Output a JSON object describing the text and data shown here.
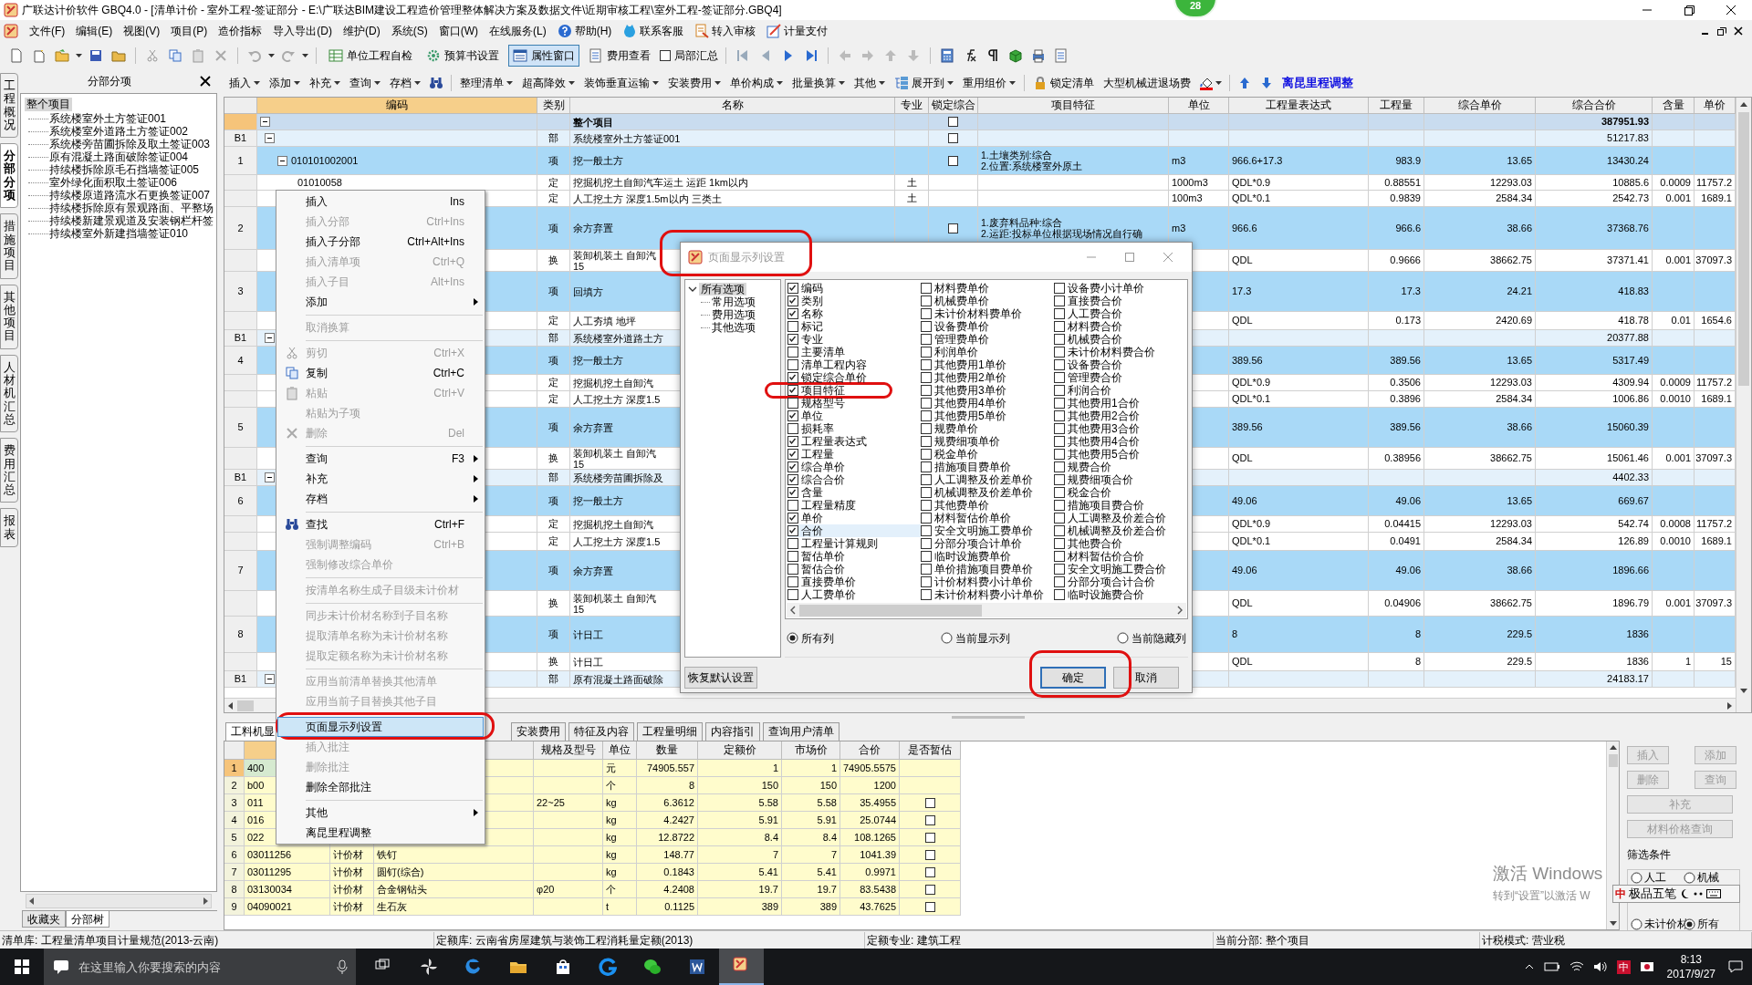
{
  "window": {
    "title": "广联达计价软件 GBQ4.0 - [清单计价 - 室外工程-签证部分 - E:\\广联达BIM建设工程造价管理整体解决方案及数据文件\\近期审核工程\\室外工程-签证部分.GBQ4]",
    "badge": "28"
  },
  "menu_bar": [
    {
      "label": "文件(F)",
      "kind": "plain"
    },
    {
      "label": "编辑(E)",
      "kind": "plain"
    },
    {
      "label": "视图(V)",
      "kind": "plain"
    },
    {
      "label": "项目(P)",
      "kind": "plain"
    },
    {
      "label": "造价指标",
      "kind": "plain"
    },
    {
      "label": "导入导出(D)",
      "kind": "plain"
    },
    {
      "label": "维护(D)",
      "kind": "plain"
    },
    {
      "label": "系统(S)",
      "kind": "plain"
    },
    {
      "label": "窗口(W)",
      "kind": "plain"
    },
    {
      "label": "在线服务(L)",
      "kind": "plain"
    },
    {
      "label": "帮助(H)",
      "kind": "icon"
    },
    {
      "label": "联系客服",
      "kind": "icon"
    },
    {
      "label": "转入审核",
      "kind": "icon"
    },
    {
      "label": "计量支付",
      "kind": "icon"
    }
  ],
  "toolbar": {
    "buttons": [
      {
        "label": "单位工程自检",
        "pressed": false
      },
      {
        "label": "预算书设置",
        "pressed": false
      },
      {
        "label": "属性窗口",
        "pressed": true
      },
      {
        "label": "费用查看",
        "pressed": false
      }
    ],
    "summary_checkbox": {
      "label": "局部汇总",
      "checked": false
    }
  },
  "grid_toolbar": [
    {
      "label": "插入",
      "kind": "dropdown"
    },
    {
      "label": "添加",
      "kind": "dropdown"
    },
    {
      "label": "补充",
      "kind": "dropdown"
    },
    {
      "label": "查询",
      "kind": "dropdown"
    },
    {
      "label": "存档",
      "kind": "dropdown"
    },
    {
      "label": "整理清单",
      "kind": "dropdown"
    },
    {
      "label": "超高降效",
      "kind": "dropdown"
    },
    {
      "label": "装饰垂直运输",
      "kind": "dropdown"
    },
    {
      "label": "安装费用",
      "kind": "dropdown"
    },
    {
      "label": "单价构成",
      "kind": "dropdown"
    },
    {
      "label": "批量换算",
      "kind": "dropdown"
    },
    {
      "label": "其他",
      "kind": "dropdown"
    },
    {
      "label": "展开到",
      "kind": "dropdown"
    },
    {
      "label": "重用组价",
      "kind": "dropdown"
    },
    {
      "label": "锁定清单",
      "kind": "plain"
    },
    {
      "label": "大型机械进退场费",
      "kind": "plain"
    },
    {
      "label": "离昆里程调整",
      "kind": "accent"
    }
  ],
  "side_tabs": [
    {
      "label": "工程概况",
      "selected": false
    },
    {
      "label": "分部分项",
      "selected": true
    },
    {
      "label": "措施项目",
      "selected": false
    },
    {
      "label": "其他项目",
      "selected": false
    },
    {
      "label": "人材机汇总",
      "selected": false
    },
    {
      "label": "费用汇总",
      "selected": false
    },
    {
      "label": "报表",
      "selected": false
    }
  ],
  "tree_panel": {
    "title": "分部分项",
    "root": {
      "label": "整个项目",
      "selected": true,
      "children": [
        {
          "label": "系统楼室外土方签证001",
          "selected": false
        },
        {
          "label": "系统楼室外道路土方签证002",
          "selected": false
        },
        {
          "label": "系统楼旁苗圃拆除及取土签证003",
          "selected": false
        },
        {
          "label": "原有混凝土路面破除签证004",
          "selected": false
        },
        {
          "label": "持续楼拆除原毛石挡墙签证005",
          "selected": false
        },
        {
          "label": "室外绿化面积取土签证006",
          "selected": false
        },
        {
          "label": "持续楼原道路流水石更换签证007",
          "selected": false
        },
        {
          "label": "持续楼拆除原有景观路面、平整场",
          "selected": false
        },
        {
          "label": "持续楼新建景观道及安装钢栏杆签",
          "selected": false
        },
        {
          "label": "持续楼室外新建挡墙签证010",
          "selected": false
        }
      ]
    },
    "tabs": [
      {
        "label": "收藏夹",
        "selected": false
      },
      {
        "label": "分部树",
        "selected": true
      }
    ]
  },
  "grid": {
    "columns": [
      "编码",
      "类别",
      "名称",
      "专业",
      "锁定综合",
      "项目特征",
      "单位",
      "工程量表达式",
      "工程量",
      "综合单价",
      "综合合价",
      "含量",
      "单价"
    ],
    "rows": [
      {
        "kind": "total",
        "selected": true,
        "expanded": true,
        "name": "整个项目",
        "locked": false,
        "total": "387951.93"
      },
      {
        "kind": "division",
        "selected": false,
        "num": "B1",
        "expanded": true,
        "type": "部",
        "name": "系统楼室外土方签证001",
        "locked": false,
        "total": "51217.83"
      },
      {
        "kind": "item",
        "selected": false,
        "num": "1",
        "expanded": true,
        "code": "010101002001",
        "type": "项",
        "name": "挖一般土方",
        "locked": false,
        "feature": [
          "1.土壤类别:综合",
          "2.位置:系统楼室外原土"
        ],
        "unit": "m3",
        "expr": "966.6+17.3",
        "qty": "983.9",
        "unit_price": "13.65",
        "total": "13430.24"
      },
      {
        "kind": "quota",
        "selected": false,
        "code": "01010058",
        "type": "定",
        "name": "挖掘机挖土自卸汽车运土 运距 1km以内",
        "spec": "土",
        "unit": "1000m3",
        "expr": "QDL*0.9",
        "qty": "0.88551",
        "unit_price": "12293.03",
        "total": "10885.6",
        "content": "0.0009",
        "price": "11757.2"
      },
      {
        "kind": "quota",
        "selected": false,
        "type": "定",
        "name": "人工挖土方 深度1.5m以内 三类土",
        "spec": "土",
        "unit": "100m3",
        "expr": "QDL*0.1",
        "qty": "0.9839",
        "unit_price": "2584.34",
        "total": "2542.73",
        "content": "0.001",
        "price": "1689.1"
      },
      {
        "kind": "item",
        "selected": false,
        "num": "2",
        "type": "项",
        "name": "余方弃置",
        "locked": false,
        "feature": [
          "1.废弃料品种:综合",
          "2.运距:投标单位根据现场情况自行确"
        ],
        "unit": "m3",
        "expr": "966.6",
        "qty": "966.6",
        "unit_price": "38.66",
        "total": "37368.76"
      },
      {
        "kind": "swap",
        "selected": false,
        "type": "换",
        "name": "装卸机装土 自卸汽",
        "name_extra": "15",
        "expr": "QDL",
        "qty": "0.9666",
        "unit_price": "38662.75",
        "total": "37371.41",
        "content": "0.001",
        "price": "37097.3"
      },
      {
        "kind": "item",
        "selected": false,
        "num": "3",
        "type": "项",
        "name": "回填方",
        "expr": "17.3",
        "qty": "17.3",
        "unit_price": "24.21",
        "total": "418.83"
      },
      {
        "kind": "quota",
        "selected": false,
        "type": "定",
        "name": "人工夯填 地坪",
        "expr": "QDL",
        "qty": "0.173",
        "unit_price": "2420.69",
        "total": "418.78",
        "content": "0.01",
        "price": "1654.6"
      },
      {
        "kind": "division",
        "selected": false,
        "num": "B1",
        "expanded": true,
        "type": "部",
        "name": "系统楼室外道路土方",
        "total": "20377.88"
      },
      {
        "kind": "item",
        "selected": false,
        "num": "4",
        "type": "项",
        "name": "挖一般土方",
        "expr": "389.56",
        "qty": "389.56",
        "unit_price": "13.65",
        "total": "5317.49"
      },
      {
        "kind": "quota",
        "selected": false,
        "type": "定",
        "name": "挖掘机挖土自卸汽",
        "expr": "QDL*0.9",
        "qty": "0.3506",
        "unit_price": "12293.03",
        "total": "4309.94",
        "content": "0.0009",
        "price": "11757.2"
      },
      {
        "kind": "quota",
        "selected": false,
        "type": "定",
        "name": "人工挖土方 深度1.5",
        "expr": "QDL*0.1",
        "qty": "0.3896",
        "unit_price": "2584.34",
        "total": "1006.86",
        "content": "0.0010",
        "price": "1689.1"
      },
      {
        "kind": "item",
        "selected": false,
        "num": "5",
        "type": "项",
        "name": "余方弃置",
        "expr": "389.56",
        "qty": "389.56",
        "unit_price": "38.66",
        "total": "15060.39"
      },
      {
        "kind": "swap",
        "selected": false,
        "type": "换",
        "name": "装卸机装土 自卸汽",
        "name_extra": "15",
        "expr": "QDL",
        "qty": "0.38956",
        "unit_price": "38662.75",
        "total": "15061.46",
        "content": "0.001",
        "price": "37097.3"
      },
      {
        "kind": "division",
        "selected": false,
        "num": "B1",
        "expanded": true,
        "type": "部",
        "name": "系统楼旁苗圃拆除及",
        "total": "4402.33"
      },
      {
        "kind": "item",
        "selected": false,
        "num": "6",
        "type": "项",
        "name": "挖一般土方",
        "expr": "49.06",
        "qty": "49.06",
        "unit_price": "13.65",
        "total": "669.67"
      },
      {
        "kind": "quota",
        "selected": false,
        "type": "定",
        "name": "挖掘机挖土自卸汽",
        "expr": "QDL*0.9",
        "qty": "0.04415",
        "unit_price": "12293.03",
        "total": "542.74",
        "content": "0.0008",
        "price": "11757.2"
      },
      {
        "kind": "quota",
        "selected": false,
        "type": "定",
        "name": "人工挖土方 深度1.5",
        "expr": "QDL*0.1",
        "qty": "0.0491",
        "unit_price": "2584.34",
        "total": "126.89",
        "content": "0.0010",
        "price": "1689.1"
      },
      {
        "kind": "item",
        "selected": false,
        "num": "7",
        "type": "项",
        "name": "余方弃置",
        "expr": "49.06",
        "qty": "49.06",
        "unit_price": "38.66",
        "total": "1896.66"
      },
      {
        "kind": "swap",
        "selected": false,
        "type": "换",
        "name": "装卸机装土 自卸汽",
        "name_extra": "15",
        "expr": "QDL",
        "qty": "0.04906",
        "unit_price": "38662.75",
        "total": "1896.79",
        "content": "0.001",
        "price": "37097.3"
      },
      {
        "kind": "item",
        "selected": false,
        "num": "8",
        "type": "项",
        "name": "计日工",
        "expr": "8",
        "qty": "8",
        "unit_price": "229.5",
        "total": "1836"
      },
      {
        "kind": "swap",
        "selected": false,
        "type": "换",
        "name": "计日工",
        "expr": "QDL",
        "qty": "8",
        "unit_price": "229.5",
        "total": "1836",
        "content": "1",
        "price": "15"
      },
      {
        "kind": "division",
        "selected": false,
        "num": "B1",
        "expanded": true,
        "type": "部",
        "name": "原有混凝土路面破除",
        "total": "24183.17"
      }
    ]
  },
  "context_menu": [
    {
      "kind": "command",
      "label": "插入",
      "shortcut": "Ins",
      "disabled": false,
      "selected": false
    },
    {
      "kind": "command",
      "label": "插入分部",
      "shortcut": "Ctrl+Ins",
      "disabled": true,
      "selected": false
    },
    {
      "kind": "command",
      "label": "插入子分部",
      "shortcut": "Ctrl+Alt+Ins",
      "disabled": false,
      "selected": false
    },
    {
      "kind": "command",
      "label": "插入清单项",
      "shortcut": "Ctrl+Q",
      "disabled": true,
      "selected": false
    },
    {
      "kind": "command",
      "label": "插入子目",
      "shortcut": "Alt+Ins",
      "disabled": true,
      "selected": false
    },
    {
      "kind": "submenu",
      "label": "添加",
      "disabled": false,
      "selected": false
    },
    {
      "kind": "separator"
    },
    {
      "kind": "command",
      "label": "取消换算",
      "disabled": true,
      "selected": false
    },
    {
      "kind": "separator"
    },
    {
      "kind": "command",
      "label": "剪切",
      "shortcut": "Ctrl+X",
      "disabled": true,
      "selected": false
    },
    {
      "kind": "command",
      "label": "复制",
      "shortcut": "Ctrl+C",
      "disabled": false,
      "selected": false
    },
    {
      "kind": "command",
      "label": "粘贴",
      "shortcut": "Ctrl+V",
      "disabled": true,
      "selected": false
    },
    {
      "kind": "command",
      "label": "粘贴为子项",
      "disabled": true,
      "selected": false
    },
    {
      "kind": "command",
      "label": "删除",
      "shortcut": "Del",
      "disabled": true,
      "selected": false
    },
    {
      "kind": "separator"
    },
    {
      "kind": "submenu",
      "label": "查询",
      "shortcut": "F3",
      "disabled": false,
      "selected": false
    },
    {
      "kind": "submenu",
      "label": "补充",
      "disabled": false,
      "selected": false
    },
    {
      "kind": "submenu",
      "label": "存档",
      "disabled": false,
      "selected": false
    },
    {
      "kind": "separator"
    },
    {
      "kind": "command",
      "label": "查找",
      "shortcut": "Ctrl+F",
      "disabled": false,
      "selected": false
    },
    {
      "kind": "command",
      "label": "强制调整编码",
      "shortcut": "Ctrl+B",
      "disabled": true,
      "selected": false
    },
    {
      "kind": "command",
      "label": "强制修改综合单价",
      "disabled": true,
      "selected": false
    },
    {
      "kind": "separator"
    },
    {
      "kind": "command",
      "label": "按清单名称生成子目级未计价材",
      "disabled": true,
      "selected": false
    },
    {
      "kind": "separator"
    },
    {
      "kind": "command",
      "label": "同步未计价材名称到子目名称",
      "disabled": true,
      "selected": false
    },
    {
      "kind": "command",
      "label": "提取清单名称为未计价材名称",
      "disabled": true,
      "selected": false
    },
    {
      "kind": "command",
      "label": "提取定额名称为未计价材名称",
      "disabled": true,
      "selected": false
    },
    {
      "kind": "separator"
    },
    {
      "kind": "command",
      "label": "应用当前清单替换其他清单",
      "disabled": true,
      "selected": false
    },
    {
      "kind": "command",
      "label": "应用当前子目替换其他子目",
      "disabled": true,
      "selected": false
    },
    {
      "kind": "separator"
    },
    {
      "kind": "command",
      "label": "页面显示列设置",
      "disabled": false,
      "selected": true
    },
    {
      "kind": "command",
      "label": "插入批注",
      "disabled": true,
      "selected": false
    },
    {
      "kind": "command",
      "label": "删除批注",
      "disabled": true,
      "selected": false
    },
    {
      "kind": "command",
      "label": "删除全部批注",
      "disabled": false,
      "selected": false
    },
    {
      "kind": "separator"
    },
    {
      "kind": "submenu",
      "label": "其他",
      "disabled": false,
      "selected": false
    },
    {
      "kind": "command",
      "label": "离昆里程调整",
      "disabled": false,
      "selected": false
    }
  ],
  "dialog": {
    "title": "页面显示列设置",
    "tree": {
      "label": "所有选项",
      "expanded": true,
      "selected": true,
      "children": [
        {
          "label": "常用选项"
        },
        {
          "label": "费用选项"
        },
        {
          "label": "其他选项"
        }
      ]
    },
    "columns": [
      [
        {
          "label": "编码",
          "checked": true,
          "selected": false
        },
        {
          "label": "类别",
          "checked": true,
          "selected": false
        },
        {
          "label": "名称",
          "checked": true,
          "selected": false
        },
        {
          "label": "标记",
          "checked": false,
          "selected": false
        },
        {
          "label": "专业",
          "checked": true,
          "selected": false
        },
        {
          "label": "主要清单",
          "checked": false,
          "selected": false
        },
        {
          "label": "清单工程内容",
          "checked": false,
          "selected": false
        },
        {
          "label": "锁定综合单价",
          "checked": true,
          "selected": false
        },
        {
          "label": "项目特征",
          "checked": true,
          "selected": false
        },
        {
          "label": "规格型号",
          "checked": false,
          "selected": false
        },
        {
          "label": "单位",
          "checked": true,
          "selected": false
        },
        {
          "label": "损耗率",
          "checked": false,
          "selected": false
        },
        {
          "label": "工程量表达式",
          "checked": true,
          "selected": false
        },
        {
          "label": "工程量",
          "checked": true,
          "selected": false
        },
        {
          "label": "综合单价",
          "checked": true,
          "selected": false
        },
        {
          "label": "综合合价",
          "checked": true,
          "selected": false
        },
        {
          "label": "含量",
          "checked": true,
          "selected": false
        },
        {
          "label": "工程量精度",
          "checked": false,
          "selected": false
        },
        {
          "label": "单价",
          "checked": true,
          "selected": false
        },
        {
          "label": "合价",
          "checked": true,
          "selected": true
        },
        {
          "label": "工程量计算规则",
          "checked": false,
          "selected": false
        },
        {
          "label": "暂估单价",
          "checked": false,
          "selected": false
        },
        {
          "label": "暂估合价",
          "checked": false,
          "selected": false
        },
        {
          "label": "直接费单价",
          "checked": false,
          "selected": false
        },
        {
          "label": "人工费单价",
          "checked": false,
          "selected": false
        }
      ],
      [
        {
          "label": "材料费单价",
          "checked": false,
          "selected": false
        },
        {
          "label": "机械费单价",
          "checked": false,
          "selected": false
        },
        {
          "label": "未计价材料费单价",
          "checked": false,
          "selected": false
        },
        {
          "label": "设备费单价",
          "checked": false,
          "selected": false
        },
        {
          "label": "管理费单价",
          "checked": false,
          "selected": false
        },
        {
          "label": "利润单价",
          "checked": false,
          "selected": false
        },
        {
          "label": "其他费用1单价",
          "checked": false,
          "selected": false
        },
        {
          "label": "其他费用2单价",
          "checked": false,
          "selected": false
        },
        {
          "label": "其他费用3单价",
          "checked": false,
          "selected": false
        },
        {
          "label": "其他费用4单价",
          "checked": false,
          "selected": false
        },
        {
          "label": "其他费用5单价",
          "checked": false,
          "selected": false
        },
        {
          "label": "规费单价",
          "checked": false,
          "selected": false
        },
        {
          "label": "规费细项单价",
          "checked": false,
          "selected": false
        },
        {
          "label": "税金单价",
          "checked": false,
          "selected": false
        },
        {
          "label": "措施项目费单价",
          "checked": false,
          "selected": false
        },
        {
          "label": "人工调整及价差单价",
          "checked": false,
          "selected": false
        },
        {
          "label": "机械调整及价差单价",
          "checked": false,
          "selected": false
        },
        {
          "label": "其他费单价",
          "checked": false,
          "selected": false
        },
        {
          "label": "材料暂估价单价",
          "checked": false,
          "selected": false
        },
        {
          "label": "安全文明施工费单价",
          "checked": false,
          "selected": false
        },
        {
          "label": "分部分项合计单价",
          "checked": false,
          "selected": false
        },
        {
          "label": "临时设施费单价",
          "checked": false,
          "selected": false
        },
        {
          "label": "单价措施项目费单价",
          "checked": false,
          "selected": false
        },
        {
          "label": "计价材料费小计单价",
          "checked": false,
          "selected": false
        },
        {
          "label": "未计价材料费小计单价",
          "checked": false,
          "selected": false
        }
      ],
      [
        {
          "label": "设备费小计单价",
          "checked": false,
          "selected": false
        },
        {
          "label": "直接费合价",
          "checked": false,
          "selected": false
        },
        {
          "label": "人工费合价",
          "checked": false,
          "selected": false
        },
        {
          "label": "材料费合价",
          "checked": false,
          "selected": false
        },
        {
          "label": "机械费合价",
          "checked": false,
          "selected": false
        },
        {
          "label": "未计价材料费合价",
          "checked": false,
          "selected": false
        },
        {
          "label": "设备费合价",
          "checked": false,
          "selected": false
        },
        {
          "label": "管理费合价",
          "checked": false,
          "selected": false
        },
        {
          "label": "利润合价",
          "checked": false,
          "selected": false
        },
        {
          "label": "其他费用1合价",
          "checked": false,
          "selected": false
        },
        {
          "label": "其他费用2合价",
          "checked": false,
          "selected": false
        },
        {
          "label": "其他费用3合价",
          "checked": false,
          "selected": false
        },
        {
          "label": "其他费用4合价",
          "checked": false,
          "selected": false
        },
        {
          "label": "其他费用5合价",
          "checked": false,
          "selected": false
        },
        {
          "label": "规费合价",
          "checked": false,
          "selected": false
        },
        {
          "label": "规费细项合价",
          "checked": false,
          "selected": false
        },
        {
          "label": "税金合价",
          "checked": false,
          "selected": false
        },
        {
          "label": "措施项目费合价",
          "checked": false,
          "selected": false
        },
        {
          "label": "人工调整及价差合价",
          "checked": false,
          "selected": false
        },
        {
          "label": "机械调整及价差合价",
          "checked": false,
          "selected": false
        },
        {
          "label": "其他费合价",
          "checked": false,
          "selected": false
        },
        {
          "label": "材料暂估价合价",
          "checked": false,
          "selected": false
        },
        {
          "label": "安全文明施工费合价",
          "checked": false,
          "selected": false
        },
        {
          "label": "分部分项合计合价",
          "checked": false,
          "selected": false
        },
        {
          "label": "临时设施费合价",
          "checked": false,
          "selected": false
        }
      ]
    ],
    "filters": [
      {
        "label": "所有列",
        "selected": true
      },
      {
        "label": "当前显示列",
        "selected": false
      },
      {
        "label": "当前隐藏列",
        "selected": false
      }
    ],
    "reset_button": "恢复默认设置",
    "buttons": [
      {
        "label": "确定",
        "default": true
      },
      {
        "label": "取消",
        "default": false
      }
    ]
  },
  "detail_tabs": [
    {
      "label": "工料机显",
      "selected": true
    },
    {
      "label": "安装费用",
      "selected": false
    },
    {
      "label": "特征及内容",
      "selected": false
    },
    {
      "label": "工程量明细",
      "selected": false
    },
    {
      "label": "内容指引",
      "selected": false
    },
    {
      "label": "查询用户清单",
      "selected": false
    }
  ],
  "detail_grid": {
    "columns": [
      "规格及型号",
      "单位",
      "数量",
      "定额价",
      "市场价",
      "合价",
      "是否暂估"
    ],
    "rows": [
      {
        "num": "1",
        "selected": true,
        "code": "400",
        "unit": "元",
        "qty": "74905.557",
        "base_price": "1",
        "market_price": "1",
        "total": "74905.5575"
      },
      {
        "num": "2",
        "selected": false,
        "code": "b00",
        "unit": "个",
        "qty": "8",
        "base_price": "150",
        "market_price": "150",
        "total": "1200"
      },
      {
        "num": "3",
        "selected": false,
        "code": "011",
        "spec": "22~25",
        "unit": "kg",
        "qty": "6.3612",
        "base_price": "5.58",
        "market_price": "5.58",
        "total": "35.4955",
        "estimate": false
      },
      {
        "num": "4",
        "selected": false,
        "code": "016",
        "unit": "kg",
        "qty": "4.2427",
        "base_price": "5.91",
        "market_price": "5.91",
        "total": "25.0744",
        "estimate": false
      },
      {
        "num": "5",
        "selected": false,
        "code": "022",
        "unit": "kg",
        "qty": "12.8722",
        "base_price": "8.4",
        "market_price": "8.4",
        "total": "108.1265",
        "estimate": false
      },
      {
        "num": "6",
        "selected": false,
        "code": "03011256",
        "type": "计价材",
        "name": "铁钉",
        "unit": "kg",
        "qty": "148.77",
        "base_price": "7",
        "market_price": "7",
        "total": "1041.39",
        "estimate": false
      },
      {
        "num": "7",
        "selected": false,
        "code": "03011295",
        "type": "计价材",
        "name": "圆钉(综合)",
        "unit": "kg",
        "qty": "0.1843",
        "base_price": "5.41",
        "market_price": "5.41",
        "total": "0.9971",
        "estimate": false
      },
      {
        "num": "8",
        "selected": false,
        "code": "03130034",
        "type": "计价材",
        "name": "合金钢钻头",
        "spec": "φ20",
        "unit": "个",
        "qty": "4.2408",
        "base_price": "19.7",
        "market_price": "19.7",
        "total": "83.5438",
        "estimate": false
      },
      {
        "num": "9",
        "selected": false,
        "code": "04090021",
        "type": "计价材",
        "name": "生石灰",
        "unit": "t",
        "qty": "0.1125",
        "base_price": "389",
        "market_price": "389",
        "total": "43.7625",
        "estimate": false
      }
    ]
  },
  "detail_side": {
    "buttons": [
      {
        "label": "插入",
        "disabled": true
      },
      {
        "label": "添加",
        "disabled": true
      },
      {
        "label": "删除",
        "disabled": true
      },
      {
        "label": "查询",
        "disabled": true
      },
      {
        "label": "补充",
        "disabled": true
      },
      {
        "label": "材料价格查询",
        "disabled": true
      }
    ],
    "filter_title": "筛选条件",
    "filters": [
      {
        "label": "人工",
        "selected": false
      },
      {
        "label": "机械",
        "selected": false
      },
      {
        "label": "未计价材",
        "selected": false
      },
      {
        "label": "所有",
        "selected": true
      }
    ]
  },
  "status_bar": [
    "清单库: 工程量清单项目计量规范(2013-云南)",
    "定额库: 云南省房屋建筑与装饰工程消耗量定额(2013)",
    "定额专业: 建筑工程",
    "当前分部: 整个项目",
    "计税模式: 营业税"
  ],
  "activation_notice": [
    "激活 Windows",
    "转到“设置”以激活 W"
  ],
  "ime_bar": {
    "mode": "中",
    "name": "极品五笔"
  },
  "taskbar": {
    "search_placeholder": "在这里输入你要搜索的内容",
    "ime": "中",
    "time": "8:13",
    "date": "2017/9/27"
  }
}
